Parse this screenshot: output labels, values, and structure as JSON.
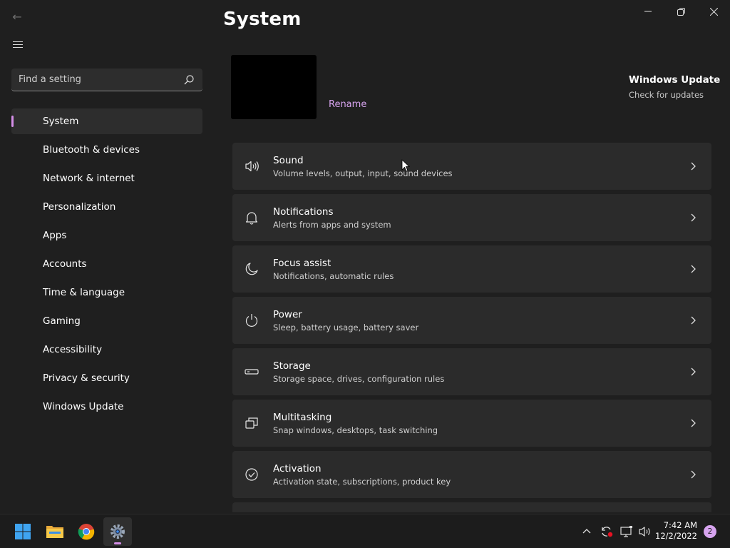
{
  "page": {
    "title": "System"
  },
  "search": {
    "placeholder": "Find a setting"
  },
  "nav": {
    "items": [
      {
        "label": "System",
        "active": true
      },
      {
        "label": "Bluetooth & devices"
      },
      {
        "label": "Network & internet"
      },
      {
        "label": "Personalization"
      },
      {
        "label": "Apps"
      },
      {
        "label": "Accounts"
      },
      {
        "label": "Time & language"
      },
      {
        "label": "Gaming"
      },
      {
        "label": "Accessibility"
      },
      {
        "label": "Privacy & security"
      },
      {
        "label": "Windows Update"
      }
    ]
  },
  "device": {
    "rename_label": "Rename"
  },
  "windows_update": {
    "title": "Windows Update",
    "subtitle": "Check for updates"
  },
  "settings": [
    {
      "icon": "speaker-icon",
      "title": "Sound",
      "subtitle": "Volume levels, output, input, sound devices"
    },
    {
      "icon": "bell-icon",
      "title": "Notifications",
      "subtitle": "Alerts from apps and system"
    },
    {
      "icon": "moon-icon",
      "title": "Focus assist",
      "subtitle": "Notifications, automatic rules"
    },
    {
      "icon": "power-icon",
      "title": "Power",
      "subtitle": "Sleep, battery usage, battery saver"
    },
    {
      "icon": "storage-drive-icon",
      "title": "Storage",
      "subtitle": "Storage space, drives, configuration rules"
    },
    {
      "icon": "multitasking-icon",
      "title": "Multitasking",
      "subtitle": "Snap windows, desktops, task switching"
    },
    {
      "icon": "check-circle-icon",
      "title": "Activation",
      "subtitle": "Activation state, subscriptions, product key"
    }
  ],
  "taskbar": {
    "time": "7:42 AM",
    "date": "12/2/2022",
    "notification_count": "2"
  },
  "colors": {
    "accent": "#d48ee7",
    "background": "#1f1f1f",
    "card": "#2b2b2b"
  }
}
